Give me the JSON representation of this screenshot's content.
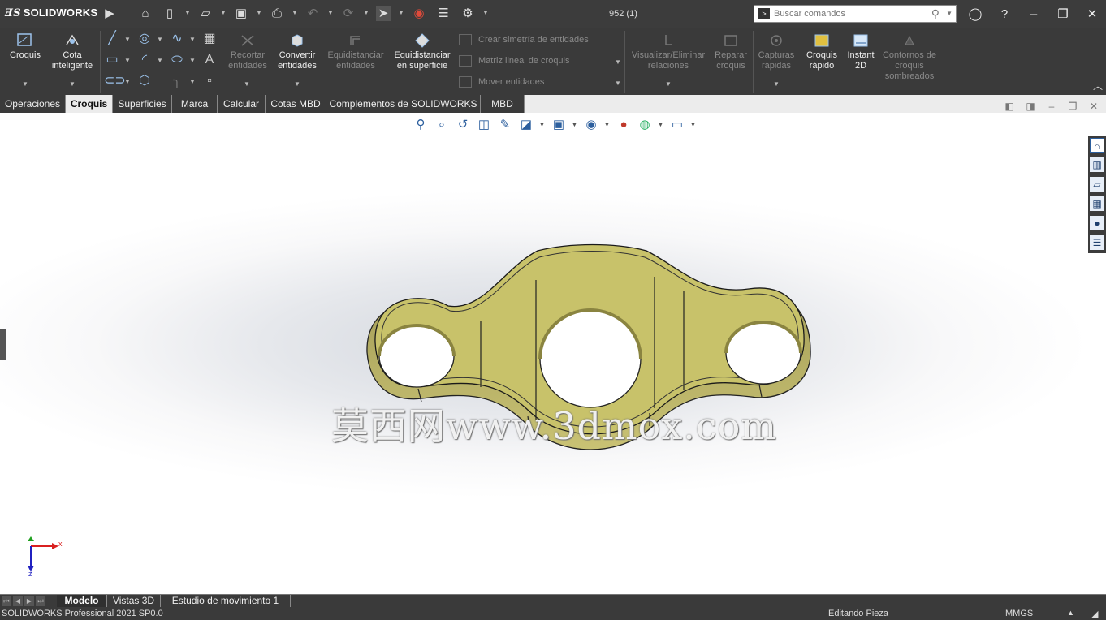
{
  "app": {
    "logo_text": "SOLIDWORKS",
    "doc_title": "952 (1)"
  },
  "search": {
    "placeholder": "Buscar comandos"
  },
  "ribbon": {
    "croquis": "Croquis",
    "cota_inteligente": "Cota inteligente",
    "recortar": "Recortar entidades",
    "convertir": "Convertir entidades",
    "equidistanciar": "Equidistanciar entidades",
    "equidistanciar_sup": "Equidistanciar en superficie",
    "simetria": "Crear simetría de entidades",
    "matriz": "Matriz lineal de croquis",
    "mover": "Mover entidades",
    "visualizar": "Visualizar/Eliminar relaciones",
    "reparar": "Reparar croquis",
    "capturas": "Capturas rápidas",
    "croquis_rapido": "Croquis rápido",
    "instant2d": "Instant 2D",
    "contornos": "Contornos de croquis sombreados"
  },
  "tabs": [
    "Operaciones",
    "Croquis",
    "Superficies",
    "Marca",
    "Calcular",
    "Cotas MBD",
    "Complementos de SOLIDWORKS",
    "MBD"
  ],
  "active_tab": "Croquis",
  "viewport": {
    "watermark": "莫西网www.3dmox.com",
    "triad": {
      "x": "x",
      "y": "y",
      "z": "z"
    },
    "part_color": "#c8c26a"
  },
  "bottom_tabs": [
    "Modelo",
    "Vistas 3D",
    "Estudio de movimiento 1"
  ],
  "status": {
    "product": "SOLIDWORKS Professional 2021 SP0.0",
    "mode": "Editando Pieza",
    "units": "MMGS"
  },
  "colors": {
    "chrome": "#3a3a3a",
    "accent": "#9cc3ec"
  }
}
